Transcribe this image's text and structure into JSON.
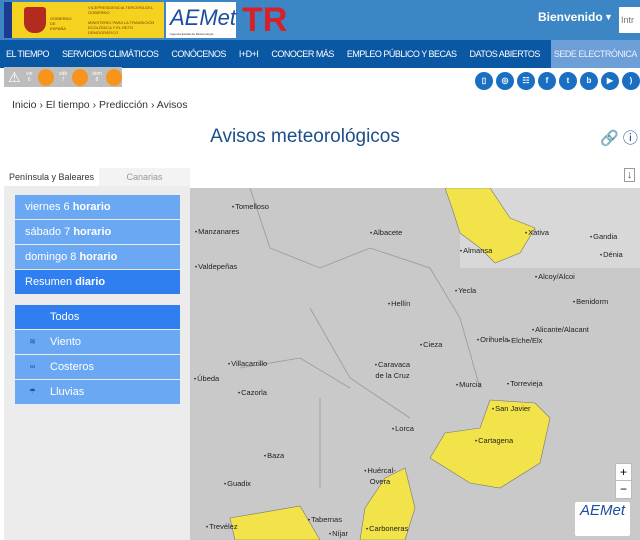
{
  "header": {
    "gov_text_1": "GOBIERNO DE ESPAÑA",
    "gov_text_2": "VICEPRESIDENCIA TERCERA DEL GOBIERNO",
    "gov_text_3": "MINISTERIO PARA LA TRANSICIÓN ECOLÓGICA Y EL RETO DEMOGRÁFICO",
    "aemet_logo": "AEMet",
    "aemet_sub": "Agencia Estatal de Meteorología",
    "tr_logo": "TR",
    "welcome": "Bienvenido",
    "search_placeholder": "Intr"
  },
  "nav": [
    "EL TIEMPO",
    "SERVICIOS CLIMÁTICOS",
    "CONÓCENOS",
    "I+D+I",
    "CONOCER MÁS",
    "EMPLEO PÚBLICO Y BECAS",
    "DATOS ABIERTOS",
    "SEDE ELECTRÓNICA"
  ],
  "warnings": [
    {
      "day": "vie",
      "num": "6"
    },
    {
      "day": "sáb",
      "num": "7"
    },
    {
      "day": "dom",
      "num": "8"
    }
  ],
  "warning_color": "#f7941d",
  "breadcrumb": [
    "Inicio",
    "›",
    "El tiempo",
    "›",
    "Predicción",
    "›",
    "Avisos"
  ],
  "title": "Avisos meteorológicos",
  "tabs": [
    "Península y Baleares",
    "Canarias"
  ],
  "days": [
    {
      "a": "viernes 6 ",
      "b": "horario"
    },
    {
      "a": "sábado 7 ",
      "b": "horario"
    },
    {
      "a": "domingo 8 ",
      "b": "horario"
    },
    {
      "a": "Resumen ",
      "b": "diario"
    }
  ],
  "filters": [
    "Todos",
    "Viento",
    "Costeros",
    "Lluvias"
  ],
  "map": {
    "cities": [
      "Tomelloso",
      "Manzanares",
      "Albacete",
      "Valdepeñas",
      "Almansa",
      "Xàtiva",
      "Gandia",
      "Dénia",
      "Alcoy/Alcoi",
      "Benidorm",
      "Hellín",
      "Yecla",
      "Alicante/Alacant",
      "Elche/Elx",
      "Cieza",
      "Villacarrillo",
      "Caravaca de la Cruz",
      "Orihuela",
      "Torrevieja",
      "Úbeda",
      "Cazorla",
      "Murcia",
      "San Javier",
      "Cartagena",
      "Lorca",
      "Baza",
      "Huércal-Overa",
      "Guadix",
      "Tabernas",
      "Níjar",
      "Carboneras",
      "Trevélez"
    ],
    "zoom_in": "+",
    "zoom_out": "−",
    "logo": "AEMet",
    "warning_fill": "#f2e34a"
  }
}
